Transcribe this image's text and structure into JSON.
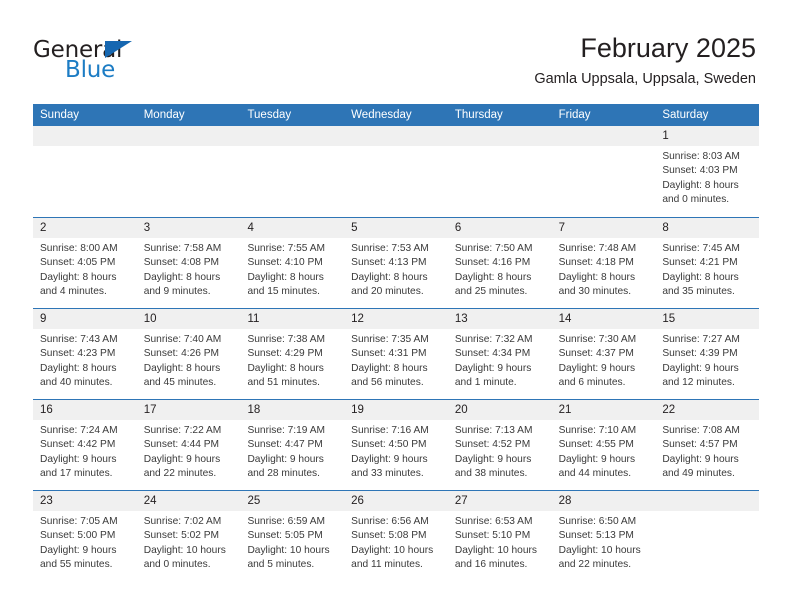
{
  "brand": {
    "name_part1": "General",
    "name_part2": "Blue",
    "triangle_color": "#1667b1",
    "blue_text_color": "#1c7cc4"
  },
  "header": {
    "title": "February 2025",
    "subtitle": "Gamla Uppsala, Uppsala, Sweden"
  },
  "theme": {
    "header_blue": "#2E75B6",
    "day_band_gray": "#F0F0F0",
    "text_color": "#231F20"
  },
  "weekdays": [
    "Sunday",
    "Monday",
    "Tuesday",
    "Wednesday",
    "Thursday",
    "Friday",
    "Saturday"
  ],
  "weeks": [
    [
      {
        "day": "",
        "sunrise": "",
        "sunset": "",
        "daylight1": "",
        "daylight2": "",
        "empty": true
      },
      {
        "day": "",
        "sunrise": "",
        "sunset": "",
        "daylight1": "",
        "daylight2": "",
        "empty": true
      },
      {
        "day": "",
        "sunrise": "",
        "sunset": "",
        "daylight1": "",
        "daylight2": "",
        "empty": true
      },
      {
        "day": "",
        "sunrise": "",
        "sunset": "",
        "daylight1": "",
        "daylight2": "",
        "empty": true
      },
      {
        "day": "",
        "sunrise": "",
        "sunset": "",
        "daylight1": "",
        "daylight2": "",
        "empty": true
      },
      {
        "day": "",
        "sunrise": "",
        "sunset": "",
        "daylight1": "",
        "daylight2": "",
        "empty": true
      },
      {
        "day": "1",
        "sunrise": "Sunrise: 8:03 AM",
        "sunset": "Sunset: 4:03 PM",
        "daylight1": "Daylight: 8 hours",
        "daylight2": "and 0 minutes.",
        "empty": false
      }
    ],
    [
      {
        "day": "2",
        "sunrise": "Sunrise: 8:00 AM",
        "sunset": "Sunset: 4:05 PM",
        "daylight1": "Daylight: 8 hours",
        "daylight2": "and 4 minutes.",
        "empty": false
      },
      {
        "day": "3",
        "sunrise": "Sunrise: 7:58 AM",
        "sunset": "Sunset: 4:08 PM",
        "daylight1": "Daylight: 8 hours",
        "daylight2": "and 9 minutes.",
        "empty": false
      },
      {
        "day": "4",
        "sunrise": "Sunrise: 7:55 AM",
        "sunset": "Sunset: 4:10 PM",
        "daylight1": "Daylight: 8 hours",
        "daylight2": "and 15 minutes.",
        "empty": false
      },
      {
        "day": "5",
        "sunrise": "Sunrise: 7:53 AM",
        "sunset": "Sunset: 4:13 PM",
        "daylight1": "Daylight: 8 hours",
        "daylight2": "and 20 minutes.",
        "empty": false
      },
      {
        "day": "6",
        "sunrise": "Sunrise: 7:50 AM",
        "sunset": "Sunset: 4:16 PM",
        "daylight1": "Daylight: 8 hours",
        "daylight2": "and 25 minutes.",
        "empty": false
      },
      {
        "day": "7",
        "sunrise": "Sunrise: 7:48 AM",
        "sunset": "Sunset: 4:18 PM",
        "daylight1": "Daylight: 8 hours",
        "daylight2": "and 30 minutes.",
        "empty": false
      },
      {
        "day": "8",
        "sunrise": "Sunrise: 7:45 AM",
        "sunset": "Sunset: 4:21 PM",
        "daylight1": "Daylight: 8 hours",
        "daylight2": "and 35 minutes.",
        "empty": false
      }
    ],
    [
      {
        "day": "9",
        "sunrise": "Sunrise: 7:43 AM",
        "sunset": "Sunset: 4:23 PM",
        "daylight1": "Daylight: 8 hours",
        "daylight2": "and 40 minutes.",
        "empty": false
      },
      {
        "day": "10",
        "sunrise": "Sunrise: 7:40 AM",
        "sunset": "Sunset: 4:26 PM",
        "daylight1": "Daylight: 8 hours",
        "daylight2": "and 45 minutes.",
        "empty": false
      },
      {
        "day": "11",
        "sunrise": "Sunrise: 7:38 AM",
        "sunset": "Sunset: 4:29 PM",
        "daylight1": "Daylight: 8 hours",
        "daylight2": "and 51 minutes.",
        "empty": false
      },
      {
        "day": "12",
        "sunrise": "Sunrise: 7:35 AM",
        "sunset": "Sunset: 4:31 PM",
        "daylight1": "Daylight: 8 hours",
        "daylight2": "and 56 minutes.",
        "empty": false
      },
      {
        "day": "13",
        "sunrise": "Sunrise: 7:32 AM",
        "sunset": "Sunset: 4:34 PM",
        "daylight1": "Daylight: 9 hours",
        "daylight2": "and 1 minute.",
        "empty": false
      },
      {
        "day": "14",
        "sunrise": "Sunrise: 7:30 AM",
        "sunset": "Sunset: 4:37 PM",
        "daylight1": "Daylight: 9 hours",
        "daylight2": "and 6 minutes.",
        "empty": false
      },
      {
        "day": "15",
        "sunrise": "Sunrise: 7:27 AM",
        "sunset": "Sunset: 4:39 PM",
        "daylight1": "Daylight: 9 hours",
        "daylight2": "and 12 minutes.",
        "empty": false
      }
    ],
    [
      {
        "day": "16",
        "sunrise": "Sunrise: 7:24 AM",
        "sunset": "Sunset: 4:42 PM",
        "daylight1": "Daylight: 9 hours",
        "daylight2": "and 17 minutes.",
        "empty": false
      },
      {
        "day": "17",
        "sunrise": "Sunrise: 7:22 AM",
        "sunset": "Sunset: 4:44 PM",
        "daylight1": "Daylight: 9 hours",
        "daylight2": "and 22 minutes.",
        "empty": false
      },
      {
        "day": "18",
        "sunrise": "Sunrise: 7:19 AM",
        "sunset": "Sunset: 4:47 PM",
        "daylight1": "Daylight: 9 hours",
        "daylight2": "and 28 minutes.",
        "empty": false
      },
      {
        "day": "19",
        "sunrise": "Sunrise: 7:16 AM",
        "sunset": "Sunset: 4:50 PM",
        "daylight1": "Daylight: 9 hours",
        "daylight2": "and 33 minutes.",
        "empty": false
      },
      {
        "day": "20",
        "sunrise": "Sunrise: 7:13 AM",
        "sunset": "Sunset: 4:52 PM",
        "daylight1": "Daylight: 9 hours",
        "daylight2": "and 38 minutes.",
        "empty": false
      },
      {
        "day": "21",
        "sunrise": "Sunrise: 7:10 AM",
        "sunset": "Sunset: 4:55 PM",
        "daylight1": "Daylight: 9 hours",
        "daylight2": "and 44 minutes.",
        "empty": false
      },
      {
        "day": "22",
        "sunrise": "Sunrise: 7:08 AM",
        "sunset": "Sunset: 4:57 PM",
        "daylight1": "Daylight: 9 hours",
        "daylight2": "and 49 minutes.",
        "empty": false
      }
    ],
    [
      {
        "day": "23",
        "sunrise": "Sunrise: 7:05 AM",
        "sunset": "Sunset: 5:00 PM",
        "daylight1": "Daylight: 9 hours",
        "daylight2": "and 55 minutes.",
        "empty": false
      },
      {
        "day": "24",
        "sunrise": "Sunrise: 7:02 AM",
        "sunset": "Sunset: 5:02 PM",
        "daylight1": "Daylight: 10 hours",
        "daylight2": "and 0 minutes.",
        "empty": false
      },
      {
        "day": "25",
        "sunrise": "Sunrise: 6:59 AM",
        "sunset": "Sunset: 5:05 PM",
        "daylight1": "Daylight: 10 hours",
        "daylight2": "and 5 minutes.",
        "empty": false
      },
      {
        "day": "26",
        "sunrise": "Sunrise: 6:56 AM",
        "sunset": "Sunset: 5:08 PM",
        "daylight1": "Daylight: 10 hours",
        "daylight2": "and 11 minutes.",
        "empty": false
      },
      {
        "day": "27",
        "sunrise": "Sunrise: 6:53 AM",
        "sunset": "Sunset: 5:10 PM",
        "daylight1": "Daylight: 10 hours",
        "daylight2": "and 16 minutes.",
        "empty": false
      },
      {
        "day": "28",
        "sunrise": "Sunrise: 6:50 AM",
        "sunset": "Sunset: 5:13 PM",
        "daylight1": "Daylight: 10 hours",
        "daylight2": "and 22 minutes.",
        "empty": false
      },
      {
        "day": "",
        "sunrise": "",
        "sunset": "",
        "daylight1": "",
        "daylight2": "",
        "empty": true
      }
    ]
  ]
}
